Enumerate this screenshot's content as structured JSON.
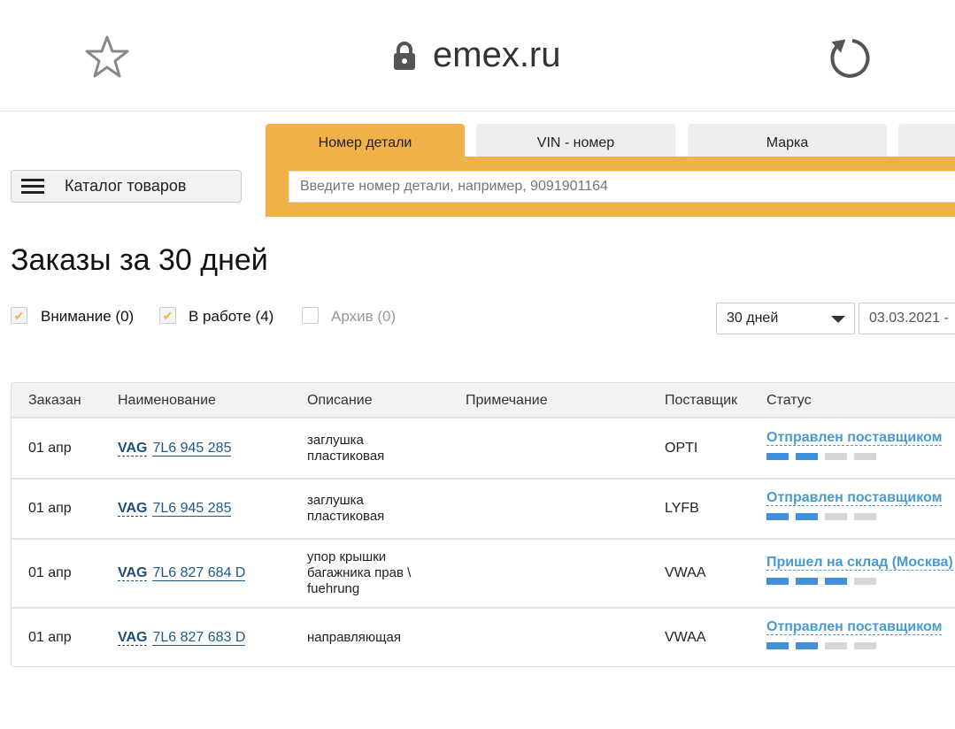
{
  "browser": {
    "url": "emex.ru",
    "icons": [
      "star-icon",
      "lock-icon",
      "reload-icon"
    ]
  },
  "search": {
    "tabs": [
      "Номер детали",
      "VIN - номер",
      "Марка"
    ],
    "placeholder": "Введите номер детали, например, 9091901164"
  },
  "catalog_label": "Каталог товаров",
  "page_title": "Заказы за 30 дней",
  "filters": [
    {
      "label": "Внимание (0)",
      "checked": true
    },
    {
      "label": "В работе (4)",
      "checked": true
    },
    {
      "label": "Архив (0)",
      "checked": false
    }
  ],
  "period": {
    "selected": "30 дней",
    "date_range": "03.03.2021 -"
  },
  "table": {
    "headers": [
      "Заказан",
      "Наименование",
      "Описание",
      "Примечание",
      "Поставщик",
      "Статус"
    ],
    "rows": [
      {
        "date": "01 апр",
        "brand": "VAG",
        "number": "7L6 945 285",
        "description": "заглушка пластиковая",
        "note": "",
        "supplier": "OPTI",
        "status": "Отправлен поставщиком",
        "progress_steps": 2,
        "total_steps": 4
      },
      {
        "date": "01 апр",
        "brand": "VAG",
        "number": "7L6 945 285",
        "description": "заглушка пластиковая",
        "note": "",
        "supplier": "LYFB",
        "status": "Отправлен поставщиком",
        "progress_steps": 2,
        "total_steps": 4
      },
      {
        "date": "01 апр",
        "brand": "VAG",
        "number": "7L6 827 684 D",
        "description": "упор крышки багажника прав \\ fuehrung",
        "note": "",
        "supplier": "VWAA",
        "status": "Пришел на склад (Москва)",
        "progress_steps": 3,
        "total_steps": 4
      },
      {
        "date": "01 апр",
        "brand": "VAG",
        "number": "7L6 827 683 D",
        "description": "направляющая",
        "note": "",
        "supplier": "VWAA",
        "status": "Отправлен поставщиком",
        "progress_steps": 2,
        "total_steps": 4
      }
    ]
  },
  "colors": {
    "accent": "#f0b148",
    "link": "#1d5a86",
    "status": "#4a9ad0",
    "progress_on": "#3f8fdc",
    "progress_off": "#d6d6d6"
  }
}
